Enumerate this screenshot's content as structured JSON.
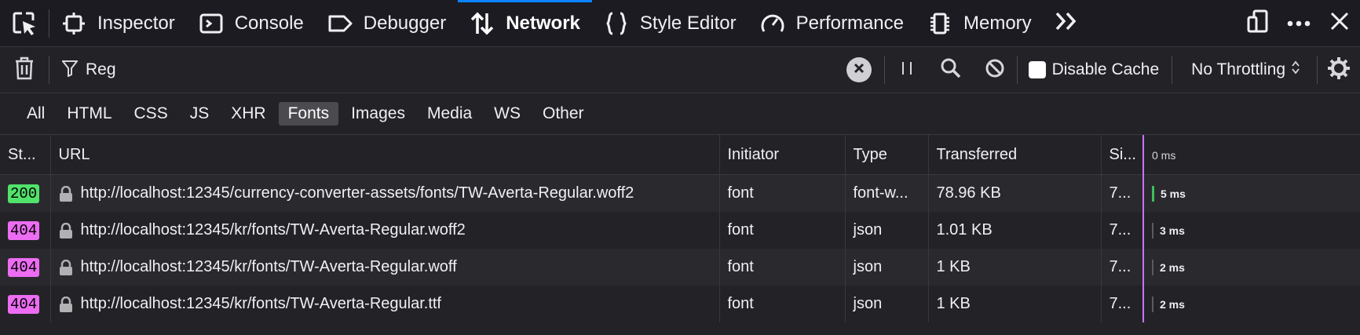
{
  "toolbar": {
    "tabs": [
      {
        "label": "Inspector",
        "icon": "inspector-icon"
      },
      {
        "label": "Console",
        "icon": "console-icon"
      },
      {
        "label": "Debugger",
        "icon": "debugger-icon"
      },
      {
        "label": "Network",
        "icon": "network-icon",
        "active": true
      },
      {
        "label": "Style Editor",
        "icon": "style-editor-icon"
      },
      {
        "label": "Performance",
        "icon": "performance-icon"
      },
      {
        "label": "Memory",
        "icon": "memory-icon"
      }
    ],
    "active_color": "#0a84ff"
  },
  "filter": {
    "value": "Reg",
    "disable_cache_label": "Disable Cache",
    "throttling_label": "No Throttling"
  },
  "type_filters": [
    {
      "label": "All"
    },
    {
      "label": "HTML"
    },
    {
      "label": "CSS"
    },
    {
      "label": "JS"
    },
    {
      "label": "XHR"
    },
    {
      "label": "Fonts",
      "active": true
    },
    {
      "label": "Images"
    },
    {
      "label": "Media"
    },
    {
      "label": "WS"
    },
    {
      "label": "Other"
    }
  ],
  "table": {
    "columns": [
      "St...",
      "URL",
      "Initiator",
      "Type",
      "Transferred",
      "Si...",
      "0 ms"
    ],
    "rows": [
      {
        "status": "200",
        "status_color": "#51e26b",
        "url": "http://localhost:12345/currency-converter-assets/fonts/TW-Averta-Regular.woff2",
        "initiator": "font",
        "type": "font-w...",
        "transferred": "78.96 KB",
        "size": "7...",
        "time": "5 ms"
      },
      {
        "status": "404",
        "status_color": "#ec6cf2",
        "url": "http://localhost:12345/kr/fonts/TW-Averta-Regular.woff2",
        "initiator": "font",
        "type": "json",
        "transferred": "1.01 KB",
        "size": "7...",
        "time": "3 ms"
      },
      {
        "status": "404",
        "status_color": "#ec6cf2",
        "url": "http://localhost:12345/kr/fonts/TW-Averta-Regular.woff",
        "initiator": "font",
        "type": "json",
        "transferred": "1 KB",
        "size": "7...",
        "time": "2 ms"
      },
      {
        "status": "404",
        "status_color": "#ec6cf2",
        "url": "http://localhost:12345/kr/fonts/TW-Averta-Regular.ttf",
        "initiator": "font",
        "type": "json",
        "transferred": "1 KB",
        "size": "7...",
        "time": "2 ms"
      }
    ]
  }
}
